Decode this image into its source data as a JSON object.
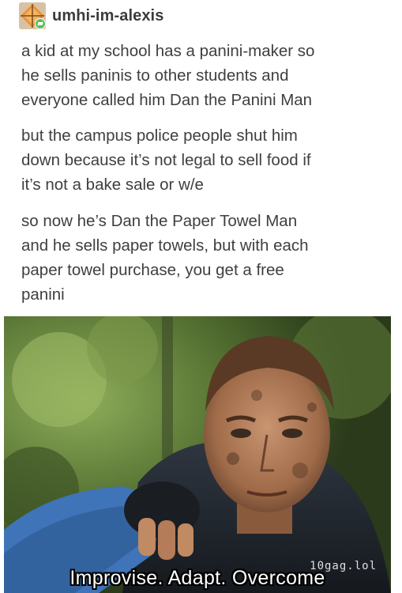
{
  "post": {
    "username": "umhi-im-alexis",
    "paragraphs": [
      "a kid at my school has a panini-maker so\nhe sells paninis to other students and\neveryone called him Dan the Panini Man",
      "but the campus police people shut him\ndown because it’s not legal to sell food if\nit’s not a bake sale or w/e",
      "so now he’s Dan the Paper Towel Man\nand he sells paper towels, but with each\npaper towel purchase, you get a free\npanini"
    ]
  },
  "meme": {
    "caption": "Improvise. Adapt. Overcome",
    "watermark": "10gag.lol"
  },
  "icons": {
    "avatar": "avatar-icon",
    "reblog": "reblog-badge-icon"
  },
  "colors": {
    "text": "#3f3f3f",
    "avatar_orange": "#e8923a",
    "reblog_green": "#5bbf5a"
  }
}
